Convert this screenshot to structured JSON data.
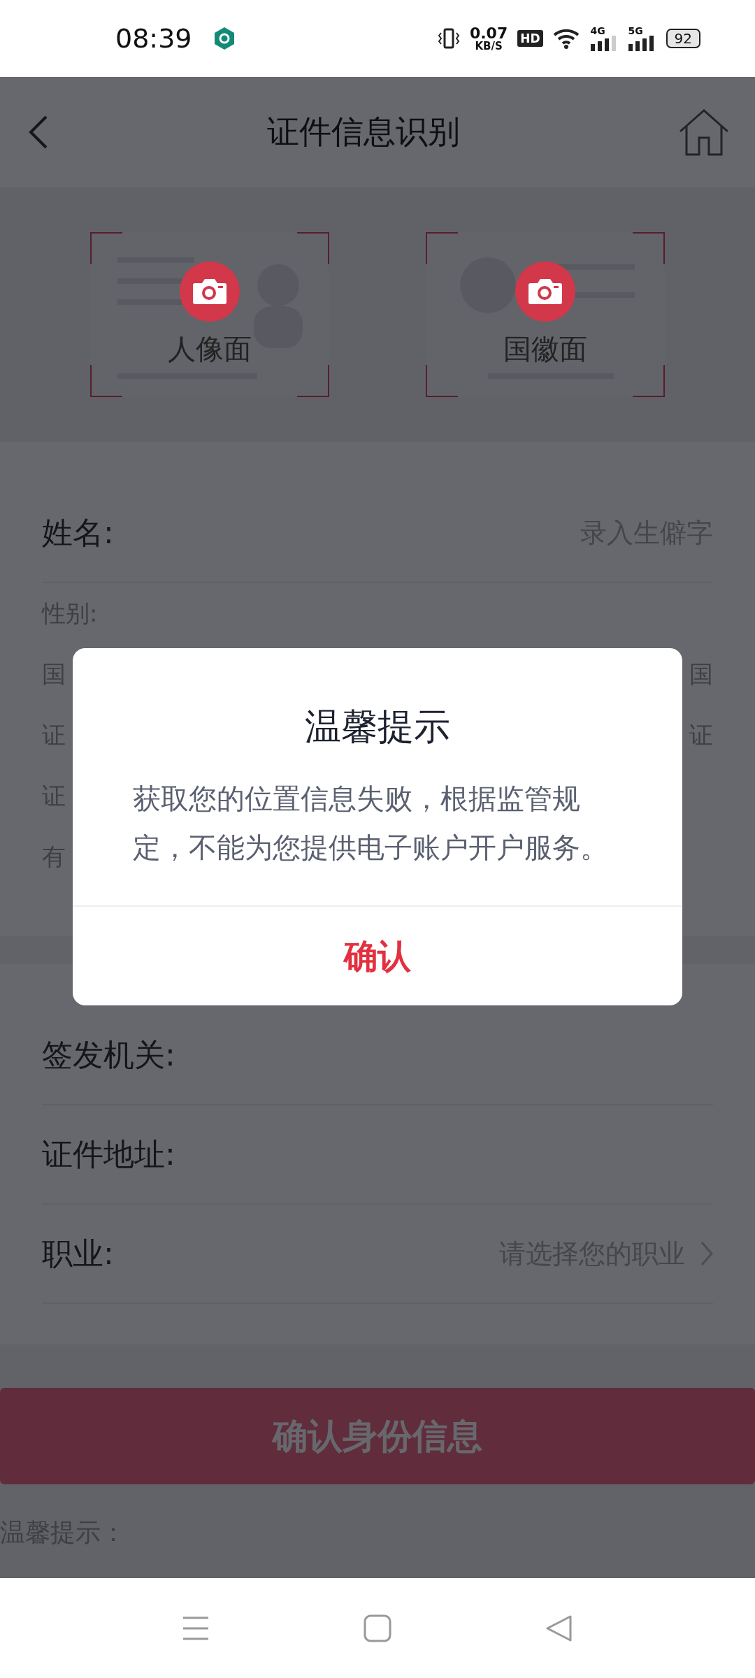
{
  "status_bar": {
    "time": "08:39",
    "net_speed": "0.07",
    "net_unit": "KB/S",
    "hd_label": "HD",
    "signals": [
      {
        "label": "4G"
      },
      {
        "label": "5G"
      }
    ],
    "battery": "92"
  },
  "header": {
    "title": "证件信息识别"
  },
  "id_cards": [
    {
      "label": "人像面",
      "kind": "portrait"
    },
    {
      "label": "国徽面",
      "kind": "emblem"
    }
  ],
  "form_sections": [
    {
      "rows": [
        {
          "kind": "main",
          "label": "姓名:",
          "action": "录入生僻字"
        },
        {
          "kind": "minor",
          "label": "性别:"
        },
        {
          "kind": "minor",
          "label": "国",
          "value": "国"
        },
        {
          "kind": "minor",
          "label": "证",
          "value": "证"
        },
        {
          "kind": "minor",
          "label": "证"
        },
        {
          "kind": "minor",
          "label": "有"
        }
      ]
    },
    {
      "rows": [
        {
          "kind": "main",
          "label": "签发机关:"
        },
        {
          "kind": "main",
          "label": "证件地址:"
        },
        {
          "kind": "select",
          "label": "职业:",
          "placeholder": "请选择您的职业"
        }
      ]
    }
  ],
  "submit_button": "确认身份信息",
  "notice_label": "温馨提示：",
  "dialog": {
    "title": "温馨提示",
    "message": "获取您的位置信息失败，根据监管规定，不能为您提供电子账户开户服务。",
    "confirm": "确认"
  }
}
